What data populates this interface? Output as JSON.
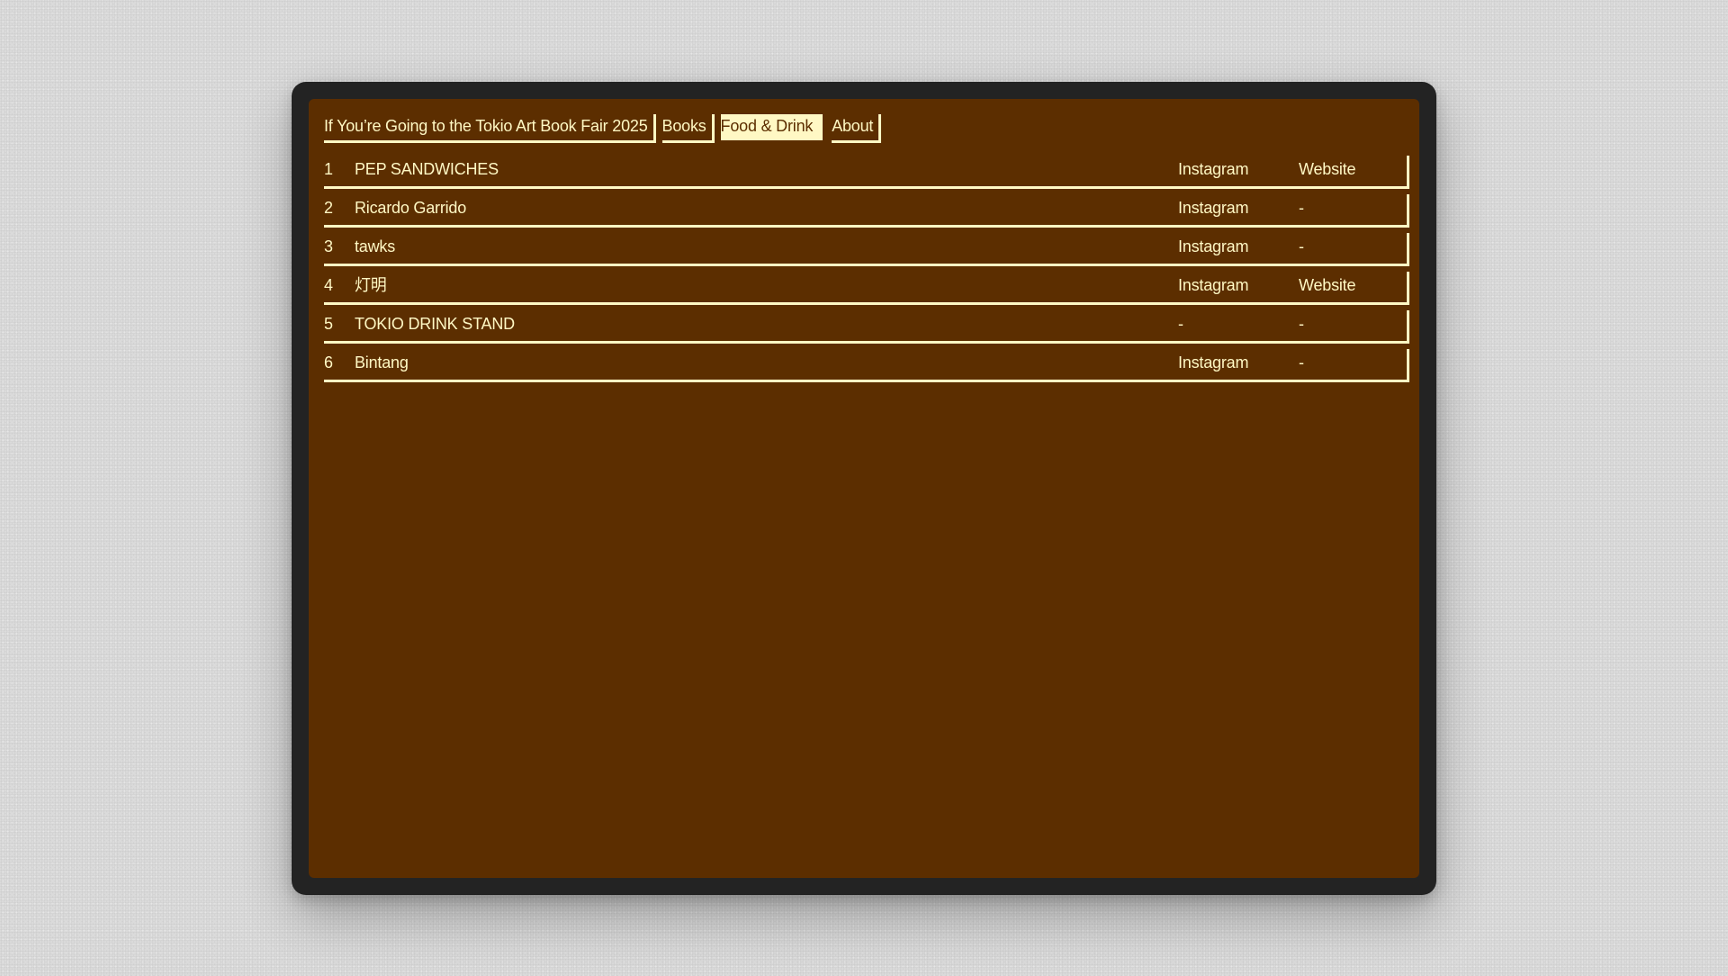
{
  "nav": {
    "title": "If You’re Going to the Tokio Art Book Fair 2025",
    "books": "Books",
    "food_drink": "Food & Drink",
    "about": "About"
  },
  "table": {
    "rows": [
      {
        "num": "1",
        "name": "PEP SANDWICHES",
        "instagram": "Instagram",
        "website": "Website"
      },
      {
        "num": "2",
        "name": "Ricardo Garrido",
        "instagram": "Instagram",
        "website": "-"
      },
      {
        "num": "3",
        "name": "tawks",
        "instagram": "Instagram",
        "website": "-"
      },
      {
        "num": "4",
        "name": "灯明",
        "instagram": "Instagram",
        "website": "Website"
      },
      {
        "num": "5",
        "name": "TOKIO DRINK STAND",
        "instagram": "-",
        "website": "-"
      },
      {
        "num": "6",
        "name": "Bintang",
        "instagram": "Instagram",
        "website": "-"
      }
    ]
  },
  "colors": {
    "background": "#5c2e00",
    "accent": "#fff8c4",
    "frame": "#232323"
  }
}
